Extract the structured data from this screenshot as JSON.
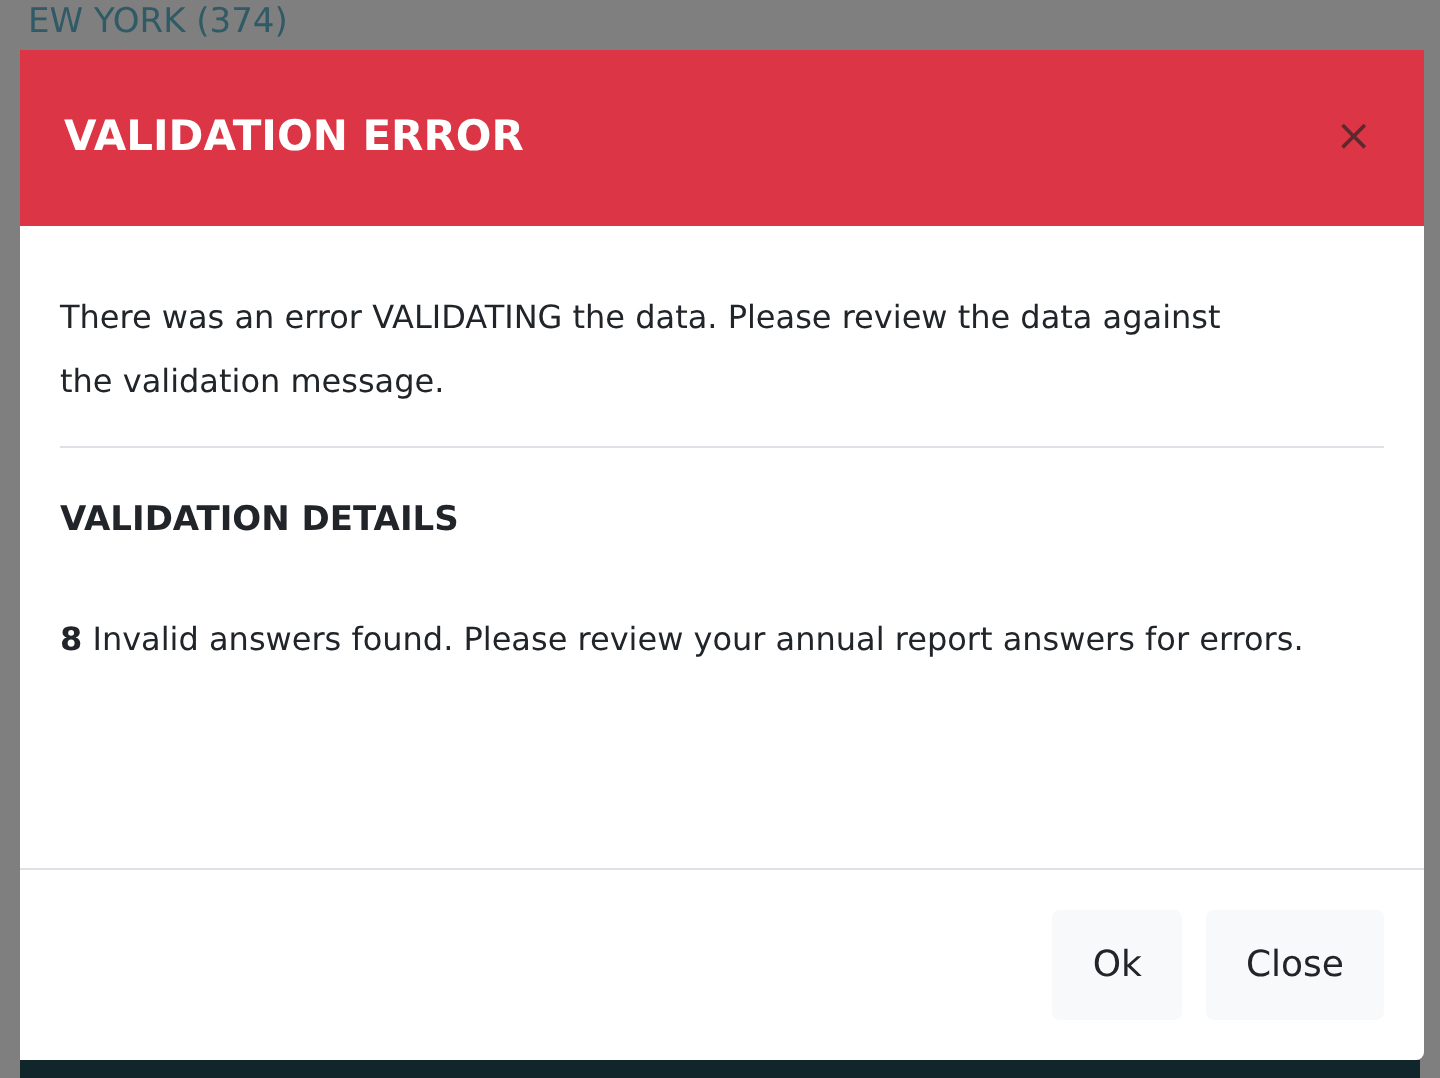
{
  "background": {
    "heading": "EW YORK (374)"
  },
  "dialog": {
    "title": "VALIDATION ERROR",
    "close_icon": "×",
    "message": "There was an error VALIDATING the data. Please review the data against the validation message.",
    "details_heading": "VALIDATION DETAILS",
    "details": "**8** Invalid answers found. Please review your annual report answers for errors.",
    "buttons": [
      "Ok",
      "Close"
    ]
  }
}
